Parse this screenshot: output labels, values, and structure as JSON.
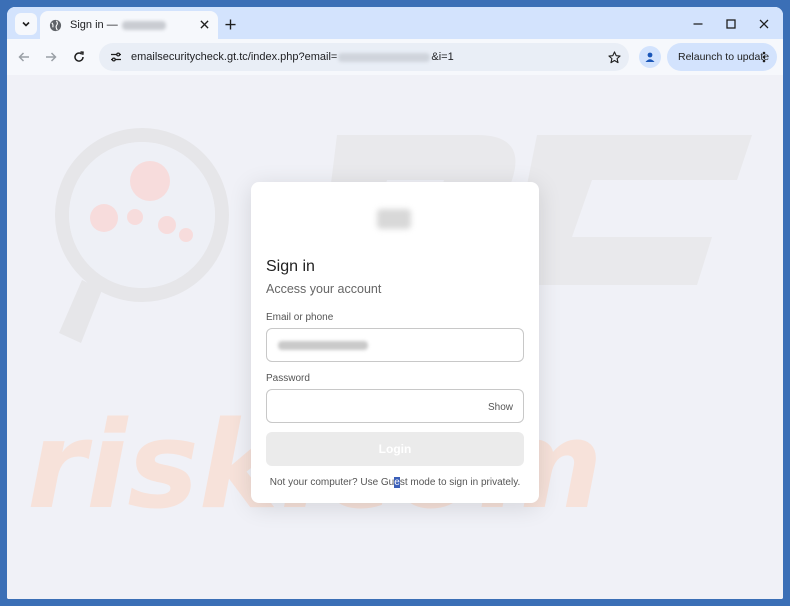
{
  "browser": {
    "tab": {
      "title": "Sign in —"
    },
    "address": {
      "url_prefix": "emailsecuritycheck.gt.tc/index.php?email=",
      "url_suffix": "&i=1"
    },
    "relaunch_label": "Relaunch to update"
  },
  "watermark": {
    "text": "risk.com"
  },
  "signin": {
    "title": "Sign in",
    "subtitle": "Access your account",
    "email_label": "Email or phone",
    "password_label": "Password",
    "show_label": "Show",
    "login_label": "Login",
    "footer": {
      "before": "Not your computer? Use Gu",
      "selected": "e",
      "after": "st mode to sign in privately."
    }
  },
  "colors": {
    "frame": "#3b6fb6",
    "tabstrip": "#d3e3fd",
    "omnibox": "#e9eef6",
    "watermark": "#f5d8cf"
  }
}
